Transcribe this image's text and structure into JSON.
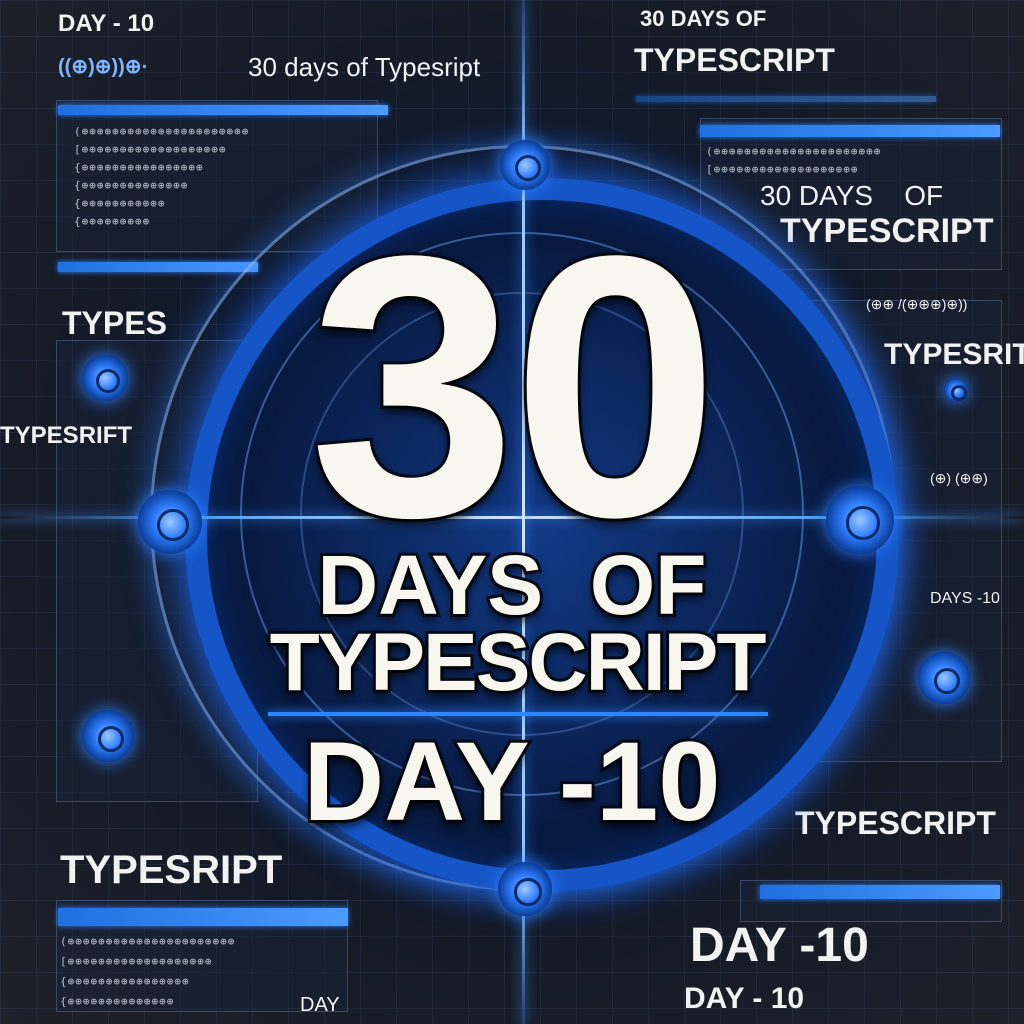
{
  "headline": {
    "number": "30",
    "line1": "DAYS  OF",
    "line2": "TYPESCRIPT",
    "line3": "DAY -10"
  },
  "background_text": {
    "top_left": "DAY - 10",
    "top_center": "30 DAYS OF",
    "top_row_lead": "((⊕)⊕))⊕∙",
    "top_row_main": "30 days of Typesript",
    "top_row_caps": "TYPESCRIPT",
    "right_days": "30 DAYS    OF",
    "right_typescript": "TYPESCRIPT",
    "left_types": "TYPES",
    "left_typesrift": "TYPESRIFT",
    "right_typesrit": "TYPESRIT",
    "right_days10": "DAYS -10",
    "right_typescript2": "TYPESCRIPT",
    "left_typesript": "TYPESRIPT",
    "bottom_day10": "DAY -10",
    "bottom_day10b": "DAY - 10",
    "bottom_day": "DAY",
    "right_code1": "(⊕⊕ /(⊕⊕⊕)⊕))",
    "right_code2": "(⊕) (⊕⊕)"
  },
  "code_snippets": [
    "(⊕⊕⊕⊕⊕⊕⊕⊕⊕⊕⊕⊕⊕⊕⊕⊕⊕⊕⊕⊕⊕⊕",
    "[⊕⊕⊕⊕⊕⊕⊕⊕⊕⊕⊕⊕⊕⊕⊕⊕⊕⊕⊕",
    "{⊕⊕⊕⊕⊕⊕⊕⊕⊕⊕⊕⊕⊕⊕⊕⊕",
    "{⊕⊕⊕⊕⊕⊕⊕⊕⊕⊕⊕⊕⊕⊕",
    "{⊕⊕⊕⊕⊕⊕⊕⊕⊕⊕⊕",
    "{⊕⊕⊕⊕⊕⊕⊕⊕⊕"
  ],
  "colors": {
    "accent": "#2b86ff",
    "ring": "#1555c8",
    "text": "#f7f6ef",
    "background": "#1c1f27"
  }
}
